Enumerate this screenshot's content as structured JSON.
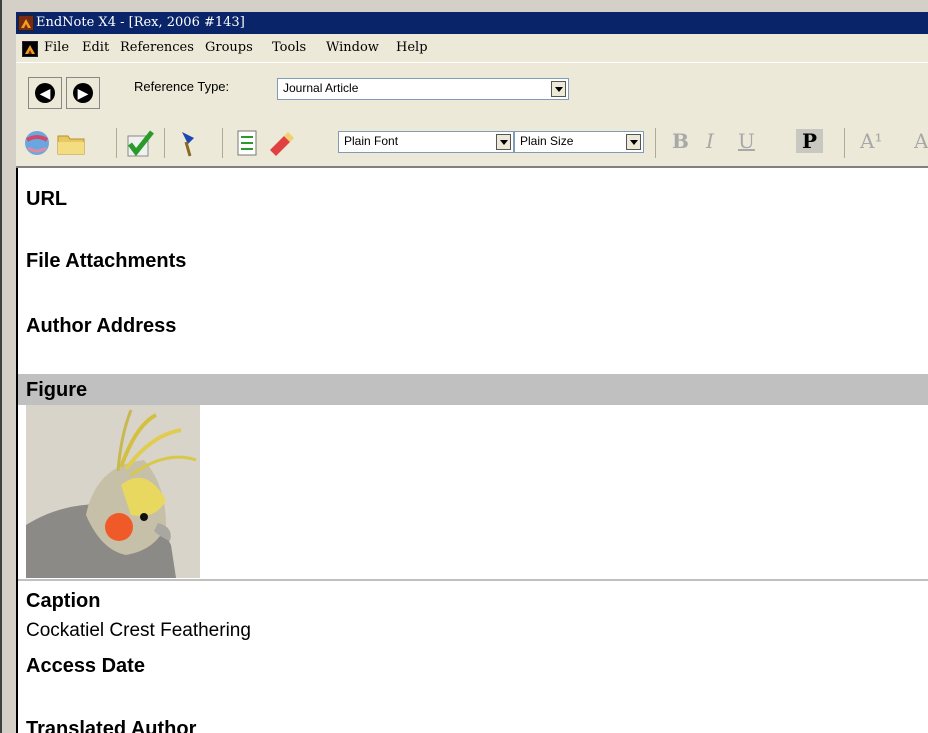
{
  "window": {
    "title": "EndNote X4 - [Rex, 2006 #143]",
    "icon": "endnote-app-icon"
  },
  "menubar": {
    "items": [
      "File",
      "Edit",
      "References",
      "Groups",
      "Tools",
      "Window",
      "Help"
    ]
  },
  "reference": {
    "type_label": "Reference Type:",
    "type_value": "Journal Article"
  },
  "toolbar": {
    "font_value": "Plain Font",
    "size_value": "Plain Size",
    "format_buttons": [
      "B",
      "I",
      "U",
      "P",
      "A¹",
      "A"
    ],
    "active_format": "P",
    "icons": [
      "globe-link-icon",
      "folder-open-icon",
      "checkmark-icon",
      "pushpin-icon",
      "checklist-icon",
      "pencil-eraser-icon"
    ]
  },
  "fields": {
    "url_label": "URL",
    "attachments_label": "File Attachments",
    "address_label": "Author Address",
    "figure_label": "Figure",
    "caption_label": "Caption",
    "caption_value": "Cockatiel Crest Feathering",
    "access_date_label": "Access Date",
    "translated_author_label": "Translated Author"
  },
  "colors": {
    "titlebar": "#0a246a",
    "chrome": "#ece9d8",
    "figure_band": "#c0c0c0"
  }
}
